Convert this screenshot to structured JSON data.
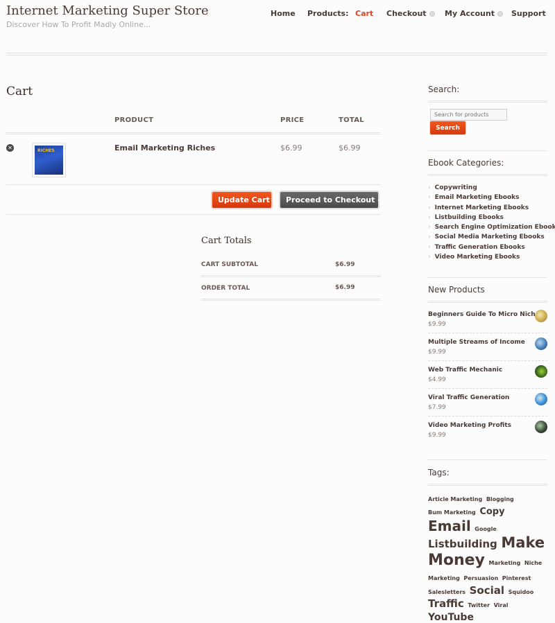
{
  "site": {
    "title": "Internet Marketing Super Store",
    "description": "Discover How To Profit Madly Online..."
  },
  "nav": {
    "items": [
      {
        "label": "Home"
      },
      {
        "label": "Products:"
      },
      {
        "label": "Cart",
        "active": true
      },
      {
        "label": "Checkout",
        "has_dropdown": true
      },
      {
        "label": "My Account",
        "has_dropdown": true
      },
      {
        "label": "Support"
      }
    ]
  },
  "cart": {
    "title": "Cart",
    "headers": {
      "product": "PRODUCT",
      "price": "PRICE",
      "total": "TOTAL"
    },
    "items": [
      {
        "name": "Email Marketing Riches",
        "price": "$6.99",
        "total": "$6.99",
        "thumb_text": "RICHES"
      }
    ],
    "update_button": "Update Cart",
    "checkout_button": "Proceed to Checkout →"
  },
  "totals": {
    "title": "Cart Totals",
    "subtotal_label": "CART SUBTOTAL",
    "subtotal_value": "$6.99",
    "order_total_label": "ORDER TOTAL",
    "order_total_value": "$6.99"
  },
  "sidebar": {
    "search": {
      "title": "Search:",
      "placeholder": "Search for products",
      "button": "Search"
    },
    "categories": {
      "title": "Ebook Categories:",
      "items": [
        "Copywriting",
        "Email Marketing Ebooks",
        "Internet Marketing Ebooks",
        "Listbuilding Ebooks",
        "Search Engine Optimization Ebooks",
        "Social Media Marketing Ebooks",
        "Traffic Generation Ebooks",
        "Video Marketing Ebooks"
      ]
    },
    "new_products": {
      "title": "New Products",
      "items": [
        {
          "name": "Beginners Guide To Micro Niches",
          "price": "$9.99"
        },
        {
          "name": "Multiple Streams of Income",
          "price": "$9.99"
        },
        {
          "name": "Web Traffic Mechanic",
          "price": "$4.99"
        },
        {
          "name": "Viral Traffic Generation",
          "price": "$7.99"
        },
        {
          "name": "Video Marketing Profits",
          "price": "$9.99"
        }
      ]
    },
    "tags": {
      "title": "Tags:",
      "items": [
        {
          "label": "Article Marketing",
          "size": 8
        },
        {
          "label": "Blogging",
          "size": 8
        },
        {
          "label": "Bum Marketing",
          "size": 8
        },
        {
          "label": "Copy",
          "size": 13
        },
        {
          "label": "Email",
          "size": 20
        },
        {
          "label": "Google",
          "size": 8
        },
        {
          "label": "Listbuilding",
          "size": 15
        },
        {
          "label": "Make",
          "size": 21
        },
        {
          "label": "Money",
          "size": 22
        },
        {
          "label": "Marketing",
          "size": 8
        },
        {
          "label": "Niche",
          "size": 8
        },
        {
          "label": "Marketing",
          "size": 8
        },
        {
          "label": "Persuasion",
          "size": 8
        },
        {
          "label": "Pinterest",
          "size": 8
        },
        {
          "label": "Salesletters",
          "size": 8
        },
        {
          "label": "Social",
          "size": 15
        },
        {
          "label": "Squidoo",
          "size": 8
        },
        {
          "label": "Traffic",
          "size": 15
        },
        {
          "label": "Twitter",
          "size": 8
        },
        {
          "label": "Viral",
          "size": 8
        },
        {
          "label": "YouTube",
          "size": 14
        }
      ]
    }
  },
  "colors": {
    "accent": "#e5431f",
    "text": "#4a3a36",
    "button_dark": "#555555"
  }
}
